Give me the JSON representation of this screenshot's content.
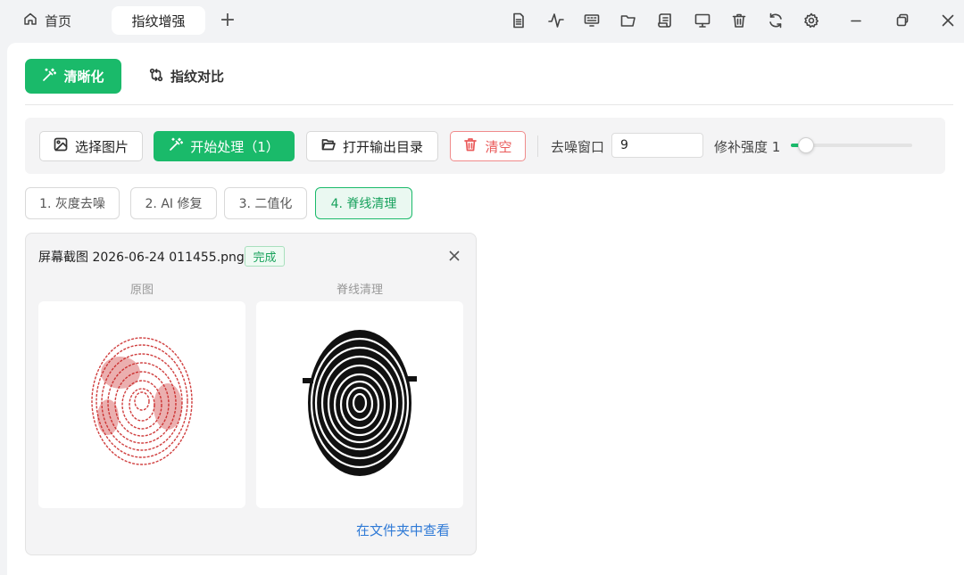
{
  "tabs": {
    "home": "首页",
    "active": "指纹增强",
    "add": "+"
  },
  "toolbar_icons": [
    "document-icon",
    "pulse-icon",
    "keyboard-icon",
    "folder-icon",
    "scroll-icon",
    "monitor-icon",
    "trash-icon",
    "refresh-icon",
    "gear-icon",
    "minimize-icon",
    "restore-icon",
    "close-icon"
  ],
  "modes": {
    "active": "清晰化",
    "inactive": "指纹对比"
  },
  "actions": {
    "select_image": "选择图片",
    "start_process": "开始处理（1）",
    "open_output": "打开输出目录",
    "clear": "清空"
  },
  "params": {
    "denoise_label": "去噪窗口",
    "denoise_value": "9",
    "repair_label": "修补强度 1",
    "repair_level": 0.08
  },
  "steps": [
    "1. 灰度去噪",
    "2. AI 修复",
    "3. 二值化",
    "4. 脊线清理"
  ],
  "active_step": 3,
  "result_card": {
    "filename": "屏幕截图 2026-06-24 011455.png",
    "status": "完成",
    "original_caption": "原图",
    "processed_caption": "脊线清理",
    "view_link": "在文件夹中查看"
  },
  "colors": {
    "accent": "#1aba6a",
    "danger": "#ea5a5a",
    "link": "#2f7ad6",
    "fingerprint_red": "#c81e1e"
  }
}
